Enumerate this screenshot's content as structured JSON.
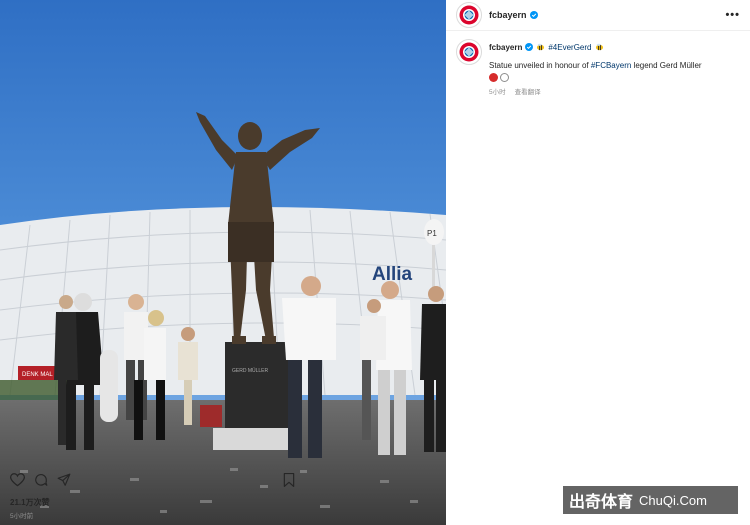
{
  "post": {
    "username": "fcbayern",
    "caption_hashtag_title": "#4EverGerd",
    "caption_text_prefix": "Statue unveiled in honour of ",
    "caption_hashtag": "#FCBayern",
    "caption_text_suffix": " legend Gerd Müller",
    "time_ago": "5小时",
    "translate_label": "查看翻译",
    "views": "21.1万次赞",
    "posted_ago": "5小时前"
  },
  "photo": {
    "plaque_text": "GERD MÜLLER",
    "stadium_sign": "Allia",
    "banner_text": "DENK MAL",
    "sign_p1": "P1"
  },
  "icons": {
    "more": "more-icon",
    "heart": "heart-icon",
    "comment": "comment-icon",
    "share": "share-icon",
    "bookmark": "bookmark-icon",
    "verified": "verified-icon",
    "bee": "bee-emoji"
  },
  "watermark": {
    "cn": "出奇体育",
    "en": "ChuQi.Com"
  },
  "colors": {
    "accent": "#0095f6",
    "hashtag": "#00376b",
    "club_red": "#dc052d"
  }
}
